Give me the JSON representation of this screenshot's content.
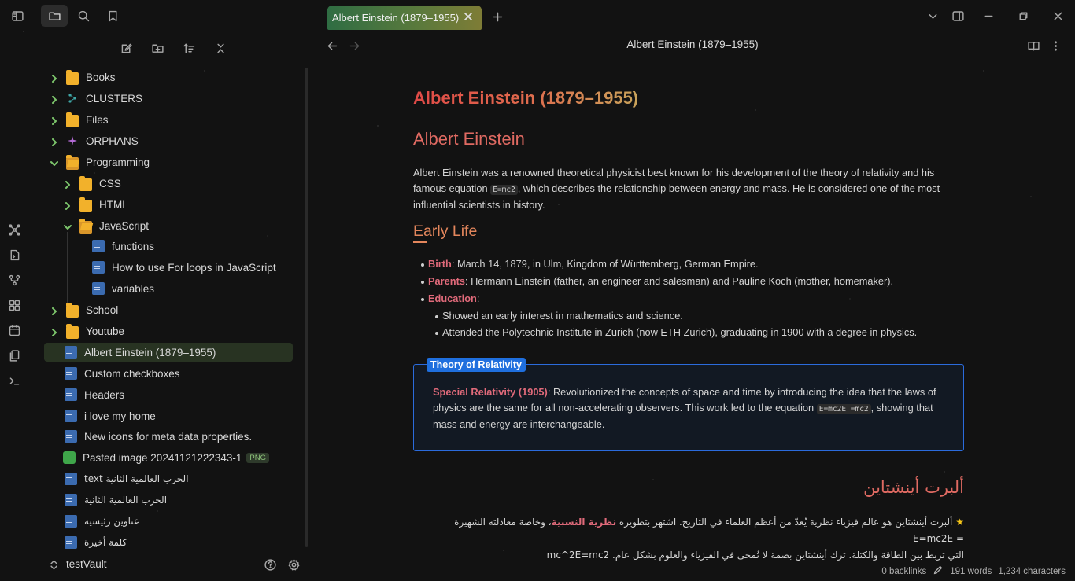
{
  "tab": {
    "title": "Albert Einstein (1879–1955)"
  },
  "header": {
    "title": "Albert Einstein (1879–1955)"
  },
  "sidebar": {
    "items": [
      {
        "label": "Books"
      },
      {
        "label": "CLUSTERS"
      },
      {
        "label": "Files"
      },
      {
        "label": "ORPHANS"
      },
      {
        "label": "Programming"
      },
      {
        "label": "CSS"
      },
      {
        "label": "HTML"
      },
      {
        "label": "JavaScript"
      },
      {
        "label": "functions"
      },
      {
        "label": "How to use For loops in JavaScript"
      },
      {
        "label": "variables"
      },
      {
        "label": "School"
      },
      {
        "label": "Youtube"
      },
      {
        "label": "Albert Einstein (1879–1955)"
      },
      {
        "label": "Custom checkboxes"
      },
      {
        "label": "Headers"
      },
      {
        "label": "i love my home"
      },
      {
        "label": "New icons for meta data properties."
      },
      {
        "label": "Pasted image 20241121222343-1",
        "badge": "PNG"
      },
      {
        "label": "text الحرب العالمية الثانية"
      },
      {
        "label": "الحرب العالمية الثانية"
      },
      {
        "label": "عناوين رئيسية"
      },
      {
        "label": "كلمة أخيرة"
      }
    ],
    "vault": "testVault"
  },
  "note": {
    "h1": "Albert Einstein (1879–1955)",
    "h2": "Albert Einstein",
    "intro_pre": "Albert Einstein was a renowned theoretical physicist best known for his development of the theory of relativity and his famous equation ",
    "intro_code": "E=mc2",
    "intro_post": ", which describes the relationship between energy and mass. He is considered one of the most influential scientists in history.",
    "h3": "Early Life",
    "birth_key": "Birth",
    "birth_val": ": March 14, 1879, in Ulm, Kingdom of Württemberg, German Empire.",
    "parents_key": "Parents",
    "parents_val": ": Hermann Einstein (father, an engineer and salesman) and Pauline Koch (mother, homemaker).",
    "education_key": "Education",
    "education_val": ":",
    "edu_1": "Showed an early interest in mathematics and science.",
    "edu_2": "Attended the Polytechnic Institute in Zurich (now ETH Zurich), graduating in 1900 with a degree in physics.",
    "callout": {
      "title": "Theory of Relativity",
      "key": "Special Relativity (1905)",
      "text_pre": ": Revolutionized the concepts of space and time by introducing the idea that the laws of physics are the same for all non-accelerating observers. This work led to the equation ",
      "code": "E=mc2E =mc2",
      "text_post": ", showing that mass and energy are interchangeable."
    },
    "ar_heading": "ألبرت أينشتاين",
    "ar_pre": "ألبرت أينشتاين هو عالم فيزياء نظرية يُعدّ من أعظم العلماء في التاريخ. اشتهر بتطويره ",
    "ar_key": "نظرية النسبية",
    "ar_post": "، وخاصة معادلته الشهيرة  =  E=mc2E",
    "ar_line2": "التي تربط بين الطاقة والكتلة. ترك أينشتاين بصمة لا تُمحى في الفيزياء والعلوم بشكل عام. mc^2E=mc2"
  },
  "status": {
    "backlinks": "0 backlinks",
    "words": "191 words",
    "characters": "1,234 characters"
  },
  "colors": {
    "accent_green": "#7cc56b",
    "folder": "#f2b12b",
    "callout_blue": "#1f6fde",
    "heading_red": "#e06a62"
  }
}
